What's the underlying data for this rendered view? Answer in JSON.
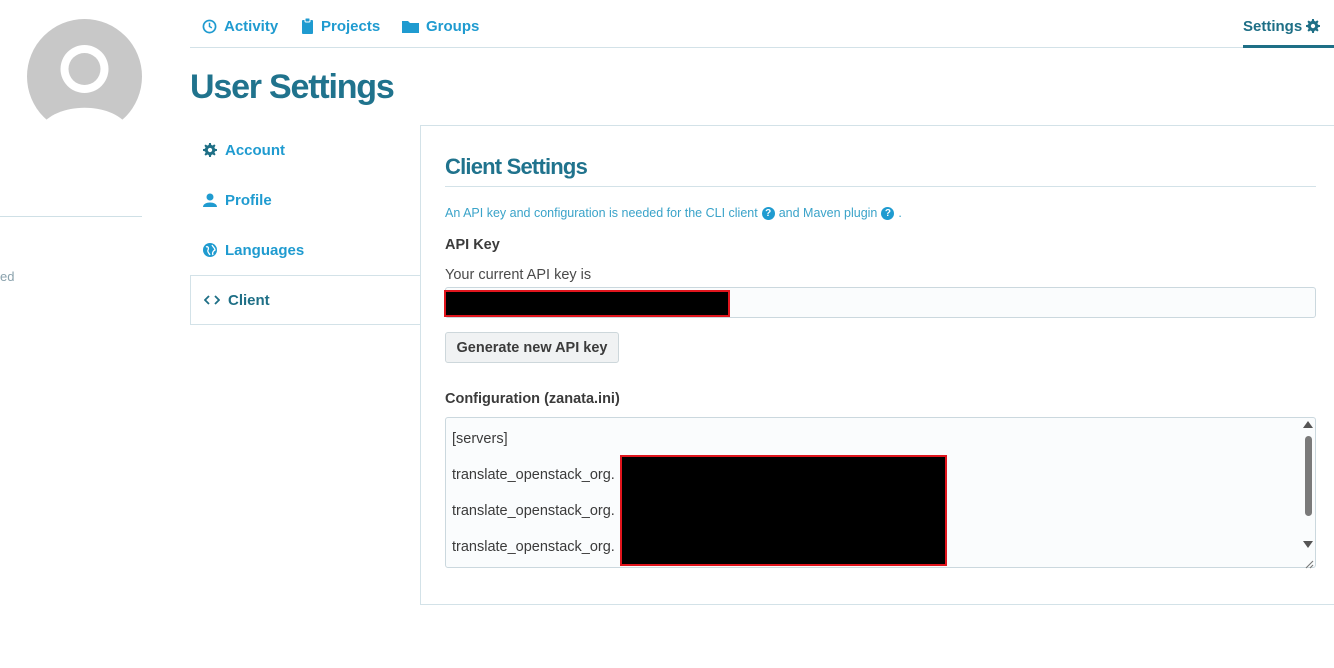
{
  "left": {
    "fragment": "ed"
  },
  "topnav": {
    "items": [
      {
        "label": "Activity",
        "icon": "clock-icon"
      },
      {
        "label": "Projects",
        "icon": "clipboard-icon"
      },
      {
        "label": "Groups",
        "icon": "folder-icon"
      }
    ],
    "settings": {
      "label": "Settings",
      "icon": "gear-icon"
    }
  },
  "page": {
    "title": "User Settings"
  },
  "sidebar": {
    "items": [
      {
        "label": "Account",
        "icon": "gear-icon"
      },
      {
        "label": "Profile",
        "icon": "user-icon"
      },
      {
        "label": "Languages",
        "icon": "globe-icon"
      },
      {
        "label": "Client",
        "icon": "code-icon",
        "active": true
      }
    ]
  },
  "client": {
    "title": "Client Settings",
    "intro_part1": "An API key and configuration is needed for the CLI client",
    "intro_part2": "and Maven plugin",
    "intro_end": ".",
    "api_key_label": "API Key",
    "api_key_desc": "Your current API key is",
    "generate_button": "Generate new API key",
    "config_label": "Configuration (zanata.ini)",
    "config_lines": [
      "[servers]",
      "translate_openstack_org.",
      "translate_openstack_org.",
      "translate_openstack_org."
    ]
  },
  "colors": {
    "accent": "#1f9bd0",
    "title": "#20738d",
    "redaction_border": "#e0151d"
  }
}
